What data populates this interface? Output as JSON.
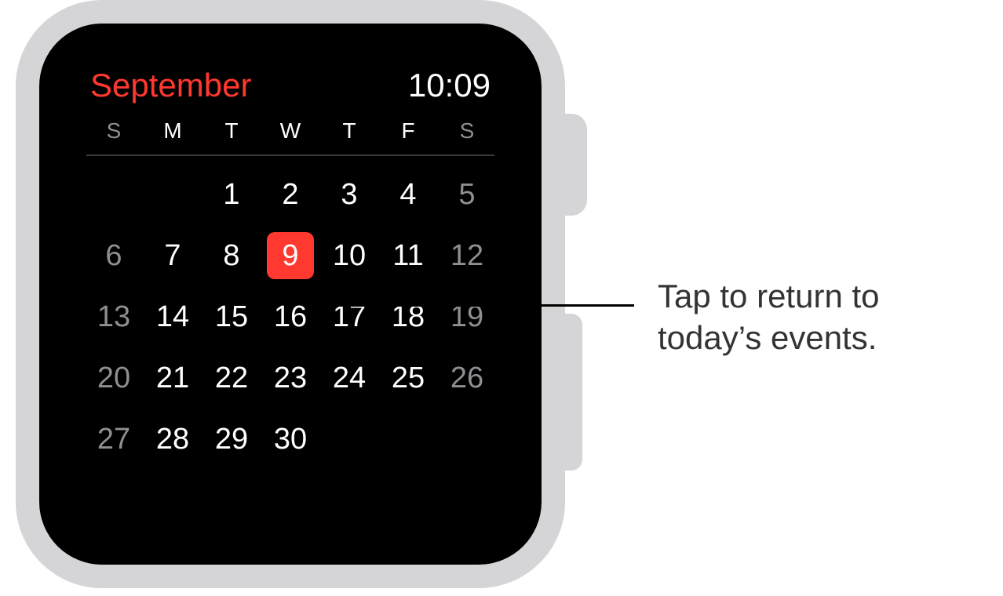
{
  "status": {
    "month": "September",
    "time": "10:09"
  },
  "weekdays": [
    "S",
    "M",
    "T",
    "W",
    "T",
    "F",
    "S"
  ],
  "calendar": {
    "weeks": [
      [
        "",
        "",
        "1",
        "2",
        "3",
        "4",
        "5"
      ],
      [
        "6",
        "7",
        "8",
        "9",
        "10",
        "11",
        "12"
      ],
      [
        "13",
        "14",
        "15",
        "16",
        "17",
        "18",
        "19"
      ],
      [
        "20",
        "21",
        "22",
        "23",
        "24",
        "25",
        "26"
      ],
      [
        "27",
        "28",
        "29",
        "30",
        "",
        "",
        ""
      ]
    ],
    "today": "9"
  },
  "callout": {
    "line1": "Tap to return to",
    "line2": "today’s events."
  }
}
